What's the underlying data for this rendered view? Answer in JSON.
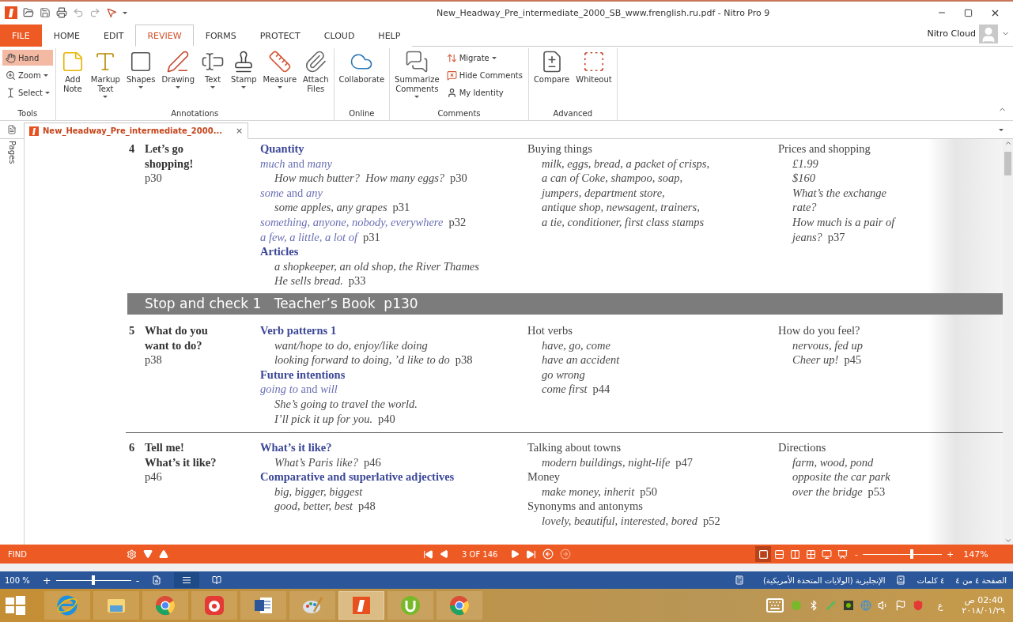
{
  "window": {
    "title": "New_Headway_Pre_intermediate_2000_SB_www.frenglish.ru.pdf - Nitro Pro 9",
    "account": "Nitro Cloud"
  },
  "menu_tabs": [
    {
      "label": "FILE",
      "kind": "file",
      "selected": false
    },
    {
      "label": "HOME",
      "kind": "tab",
      "selected": false
    },
    {
      "label": "EDIT",
      "kind": "tab",
      "selected": false
    },
    {
      "label": "REVIEW",
      "kind": "tab",
      "selected": true
    },
    {
      "label": "FORMS",
      "kind": "tab",
      "selected": false
    },
    {
      "label": "PROTECT",
      "kind": "tab",
      "selected": false
    },
    {
      "label": "CLOUD",
      "kind": "tab",
      "selected": false
    },
    {
      "label": "HELP",
      "kind": "tab",
      "selected": false
    }
  ],
  "ribbon": {
    "groups": [
      {
        "label": "Tools",
        "items": [
          {
            "label": "Hand",
            "kind": "small",
            "dropdown": false,
            "selected": true
          },
          {
            "label": "Zoom",
            "kind": "small",
            "dropdown": true,
            "selected": false
          },
          {
            "label": "Select",
            "kind": "small",
            "dropdown": true,
            "selected": false
          }
        ]
      },
      {
        "label": "Annotations",
        "items": [
          {
            "label": "Add\nNote",
            "kind": "large",
            "dropdown": false
          },
          {
            "label": "Markup\nText",
            "kind": "large",
            "dropdown": true
          },
          {
            "label": "Shapes",
            "kind": "large",
            "dropdown": true
          },
          {
            "label": "Drawing",
            "kind": "large",
            "dropdown": true
          },
          {
            "label": "Text",
            "kind": "large",
            "dropdown": true
          },
          {
            "label": "Stamp",
            "kind": "large",
            "dropdown": true
          },
          {
            "label": "Measure",
            "kind": "large",
            "dropdown": true
          },
          {
            "label": "Attach\nFiles",
            "kind": "large",
            "dropdown": false
          }
        ]
      },
      {
        "label": "Online",
        "items": [
          {
            "label": "Collaborate",
            "kind": "large",
            "dropdown": false
          }
        ]
      },
      {
        "label": "Comments",
        "items": [
          {
            "label": "Summarize\nComments",
            "kind": "large",
            "dropdown": true
          },
          {
            "label": "Migrate",
            "kind": "small",
            "dropdown": true
          },
          {
            "label": "Hide Comments",
            "kind": "small",
            "dropdown": false
          },
          {
            "label": "My Identity",
            "kind": "small",
            "dropdown": false
          }
        ]
      },
      {
        "label": "Advanced",
        "items": [
          {
            "label": "Compare",
            "kind": "large",
            "dropdown": false
          },
          {
            "label": "Whiteout",
            "kind": "large",
            "dropdown": false
          }
        ]
      }
    ]
  },
  "document_tab": {
    "title": "New_Headway_Pre_intermediate_2000...",
    "close": "×"
  },
  "sidebar": {
    "label": "Pages"
  },
  "document": {
    "sections": [
      {
        "kind": "unit",
        "number": "4",
        "title": "Let’s go\nshopping!",
        "page": "p30",
        "columns": [
          [
            {
              "kind": "head",
              "text": "Quantity"
            },
            {
              "kind": "topic",
              "text": "*much* and *many*"
            },
            {
              "kind": "ex",
              "text": "How much butter?  How many eggs?",
              "page": "p30"
            },
            {
              "kind": "topic",
              "text": "*some* and *any*"
            },
            {
              "kind": "ex",
              "text": "some apples, any grapes",
              "page": "p31"
            },
            {
              "kind": "phrase",
              "text": "something, anyone, nobody, everywhere",
              "page": "p32"
            },
            {
              "kind": "phrase",
              "text": "a few, a little, a lot of",
              "page": "p31"
            },
            {
              "kind": "head",
              "text": "Articles"
            },
            {
              "kind": "ex",
              "text": "a shopkeeper, an old shop, the River Thames"
            },
            {
              "kind": "ex",
              "text": "He sells bread.",
              "page": "p33"
            }
          ],
          [
            {
              "kind": "label",
              "text": "Buying things"
            },
            {
              "kind": "ex",
              "text": "milk, eggs, bread, a packet of crisps,"
            },
            {
              "kind": "ex",
              "text": "a can of Coke, shampoo, soap,"
            },
            {
              "kind": "ex",
              "text": "jumpers, department store,"
            },
            {
              "kind": "ex",
              "text": "antique shop, newsagent, trainers,"
            },
            {
              "kind": "ex",
              "text": "a tie, conditioner, first class stamps"
            }
          ],
          [
            {
              "kind": "label",
              "text": "Prices and shopping"
            },
            {
              "kind": "ex",
              "text": "£1.99"
            },
            {
              "kind": "ex",
              "text": "$160"
            },
            {
              "kind": "ex",
              "text": "What’s the exchange"
            },
            {
              "kind": "ex",
              "text": "rate?"
            },
            {
              "kind": "ex",
              "text": "How much is a pair of"
            },
            {
              "kind": "ex",
              "text": "jeans?",
              "page": "p37"
            }
          ]
        ]
      },
      {
        "kind": "band",
        "text": "Stop and check 1   Teacher’s Book  p130"
      },
      {
        "kind": "unit",
        "number": "5",
        "title": "What do you\nwant to do?",
        "page": "p38",
        "columns": [
          [
            {
              "kind": "head",
              "text": "Verb patterns 1"
            },
            {
              "kind": "ex",
              "text": "want/hope to do, enjoy/like doing"
            },
            {
              "kind": "ex",
              "text": "looking forward to doing, ’d like to do",
              "page": "p38"
            },
            {
              "kind": "head",
              "text": "Future intentions"
            },
            {
              "kind": "topic",
              "text": "*going to* and *will*"
            },
            {
              "kind": "ex",
              "text": "She’s going to travel the world."
            },
            {
              "kind": "ex",
              "text": "I’ll pick it up for you.",
              "page": "p40"
            }
          ],
          [
            {
              "kind": "label",
              "text": "Hot verbs"
            },
            {
              "kind": "ex",
              "text": "have, go, come"
            },
            {
              "kind": "ex",
              "text": "have an accident"
            },
            {
              "kind": "ex",
              "text": "go wrong"
            },
            {
              "kind": "ex",
              "text": "come first",
              "page": "p44"
            }
          ],
          [
            {
              "kind": "label",
              "text": "How do you feel?"
            },
            {
              "kind": "ex",
              "text": "nervous, fed up"
            },
            {
              "kind": "ex",
              "text": "Cheer up!",
              "page": "p45"
            }
          ]
        ]
      },
      {
        "kind": "rule"
      },
      {
        "kind": "unit",
        "number": "6",
        "title": "Tell me!\nWhat’s it like?",
        "page": "p46",
        "columns": [
          [
            {
              "kind": "head",
              "text": "What’s it like?"
            },
            {
              "kind": "ex",
              "text": "What’s Paris like?",
              "page": "p46"
            },
            {
              "kind": "head",
              "text": "Comparative and superlative adjectives"
            },
            {
              "kind": "ex",
              "text": "big, bigger, biggest"
            },
            {
              "kind": "ex",
              "text": "good, better, best",
              "page": "p48"
            }
          ],
          [
            {
              "kind": "label",
              "text": "Talking about towns"
            },
            {
              "kind": "ex",
              "text": "modern buildings, night-life",
              "page": "p47"
            },
            {
              "kind": "label",
              "text": "Money"
            },
            {
              "kind": "ex",
              "text": "make money, inherit",
              "page": "p50"
            },
            {
              "kind": "label",
              "text": "Synonyms and antonyms"
            },
            {
              "kind": "ex",
              "text": "lovely, beautiful, interested, bored",
              "page": "p52"
            }
          ],
          [
            {
              "kind": "label",
              "text": "Directions"
            },
            {
              "kind": "ex",
              "text": "farm, wood, pond"
            },
            {
              "kind": "ex",
              "text": "opposite the car park"
            },
            {
              "kind": "ex",
              "text": "over the bridge",
              "page": "p53"
            }
          ]
        ]
      }
    ]
  },
  "find_bar": {
    "label": "FIND",
    "page_indicator": "3 OF 146",
    "views": [
      {
        "selected": true
      },
      {
        "selected": false
      },
      {
        "selected": false
      },
      {
        "selected": false
      },
      {
        "selected": false
      },
      {
        "selected": false
      }
    ],
    "zoom": {
      "minus": "-",
      "plus": "+",
      "level": 0.62,
      "reading": "147%"
    }
  },
  "word_status_bar": {
    "zoom_reading": "100 %",
    "plus": "+",
    "minus": "-",
    "zoom": {
      "level": 0.5
    },
    "views": [
      {
        "selected": false
      },
      {
        "selected": true
      },
      {
        "selected": false
      }
    ],
    "language": "الإنجليزية (الولايات المتحدة الأمريكية)",
    "words": "٤ كلمات",
    "page": "الصفحة ٤ من ٤"
  },
  "taskbar": {
    "apps": [
      {
        "active": false
      },
      {
        "active": false
      },
      {
        "active": false
      },
      {
        "active": false
      },
      {
        "active": false
      },
      {
        "active": false
      },
      {
        "active": true
      },
      {
        "active": false
      },
      {
        "active": false
      }
    ],
    "language": "ع",
    "time": "02:40 ص",
    "date": "٢٠١٨/٠١/٢٩"
  }
}
